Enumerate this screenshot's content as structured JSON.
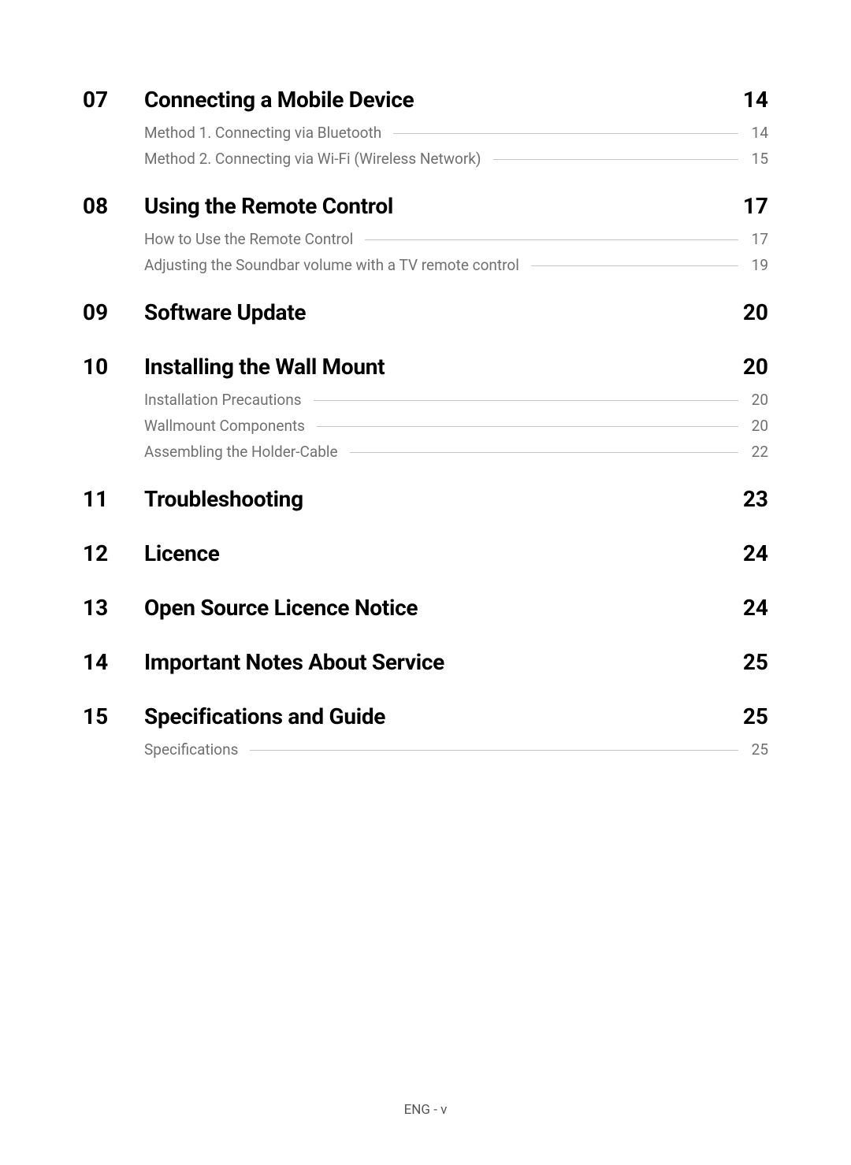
{
  "sections": [
    {
      "number": "07",
      "title": "Connecting a Mobile Device",
      "page": "14",
      "subs": [
        {
          "title": "Method 1. Connecting via Bluetooth",
          "page": "14"
        },
        {
          "title": "Method 2. Connecting via Wi-Fi (Wireless Network)",
          "page": "15"
        }
      ]
    },
    {
      "number": "08",
      "title": "Using the Remote Control",
      "page": "17",
      "subs": [
        {
          "title": "How to Use the Remote Control",
          "page": "17"
        },
        {
          "title": "Adjusting the Soundbar volume with a TV remote control",
          "page": "19"
        }
      ]
    },
    {
      "number": "09",
      "title": "Software Update",
      "page": "20",
      "subs": []
    },
    {
      "number": "10",
      "title": "Installing the Wall Mount",
      "page": "20",
      "subs": [
        {
          "title": "Installation Precautions",
          "page": "20"
        },
        {
          "title": "Wallmount Components",
          "page": "20"
        },
        {
          "title": "Assembling the Holder-Cable",
          "page": "22"
        }
      ]
    },
    {
      "number": "11",
      "title": "Troubleshooting",
      "page": "23",
      "subs": []
    },
    {
      "number": "12",
      "title": "Licence",
      "page": "24",
      "subs": []
    },
    {
      "number": "13",
      "title": "Open Source Licence Notice",
      "page": "24",
      "subs": []
    },
    {
      "number": "14",
      "title": "Important Notes About Service",
      "page": "25",
      "subs": []
    },
    {
      "number": "15",
      "title": "Specifications and Guide",
      "page": "25",
      "subs": [
        {
          "title": "Specifications",
          "page": "25"
        }
      ]
    }
  ],
  "footer": "ENG - v"
}
